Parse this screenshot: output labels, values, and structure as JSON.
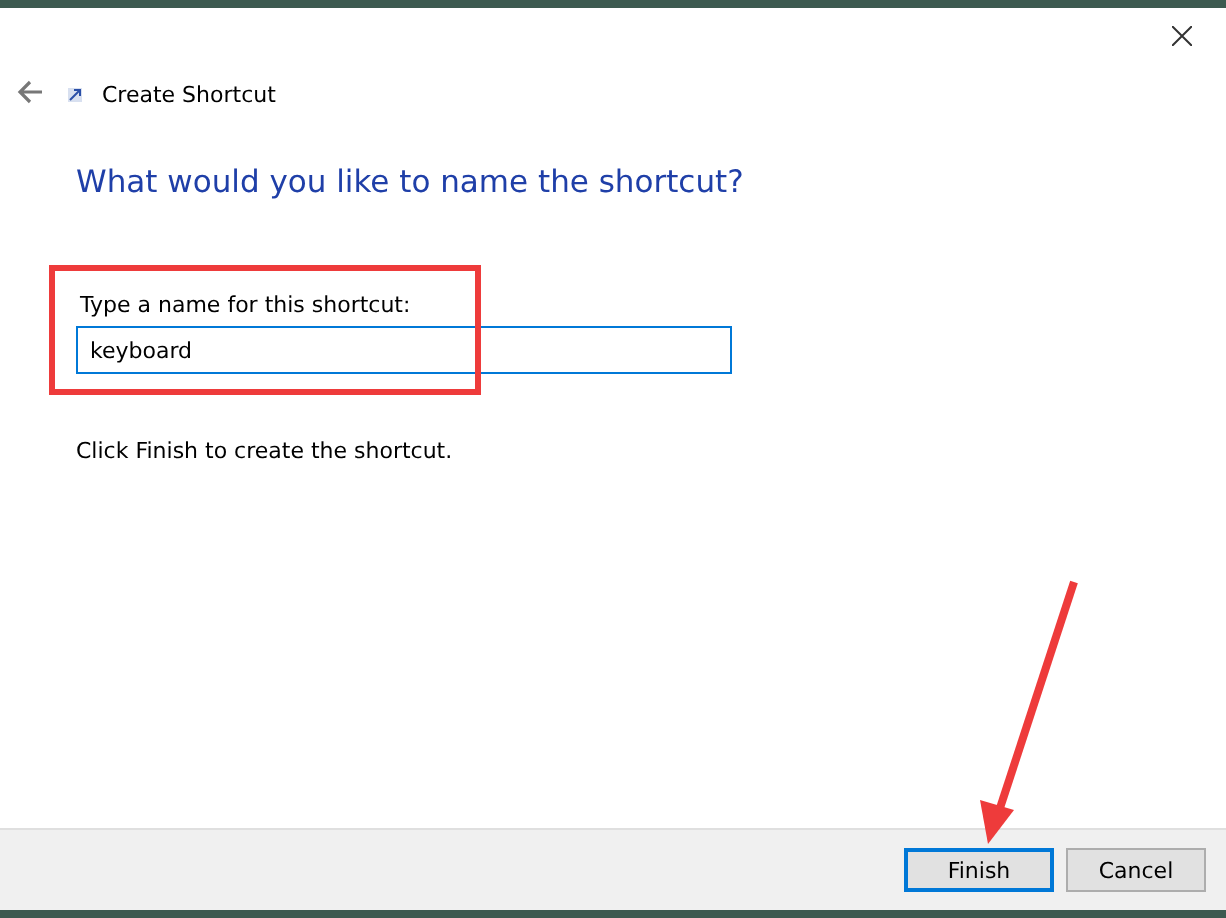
{
  "window": {
    "title": "Create Shortcut"
  },
  "heading": "What would you like to name the shortcut?",
  "name_field": {
    "label": "Type a name for this shortcut:",
    "value": "keyboard",
    "focused": true
  },
  "instruction": "Click Finish to create the shortcut.",
  "buttons": [
    {
      "label": "Finish",
      "default": true
    },
    {
      "label": "Cancel",
      "default": false
    }
  ]
}
